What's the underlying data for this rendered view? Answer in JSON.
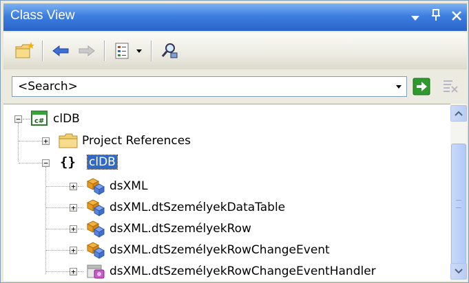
{
  "window": {
    "title": "Class View"
  },
  "toolbar": {
    "buttons": [
      {
        "icon": "new-folder-icon"
      },
      {
        "icon": "back-arrow-icon"
      },
      {
        "icon": "forward-arrow-icon"
      },
      {
        "icon": "view-settings-icon"
      },
      {
        "icon": "dropdown-arrow-icon"
      },
      {
        "icon": "find-symbol-icon"
      }
    ]
  },
  "search": {
    "value": "<Search>"
  },
  "tree": {
    "root": {
      "label": "clDB",
      "icon": "csharp-project-icon"
    },
    "children": [
      {
        "label": "Project References",
        "icon": "folder-icon"
      },
      {
        "label": "clDB",
        "icon": "namespace-icon",
        "selected": true
      }
    ],
    "classes": [
      {
        "label": "dsXML",
        "icon": "class-icon"
      },
      {
        "label": "dsXML.dtSzemélyekDataTable",
        "icon": "class-icon"
      },
      {
        "label": "dsXML.dtSzemélyekRow",
        "icon": "class-icon"
      },
      {
        "label": "dsXML.dtSzemélyekRowChangeEvent",
        "icon": "class-icon"
      },
      {
        "label": "dsXML.dtSzemélyekRowChangeEventHandler",
        "icon": "delegate-icon"
      }
    ]
  },
  "colors": {
    "titlebar": "#3d7fe0",
    "selection": "#316ac5",
    "go_button": "#2e9a2e"
  }
}
